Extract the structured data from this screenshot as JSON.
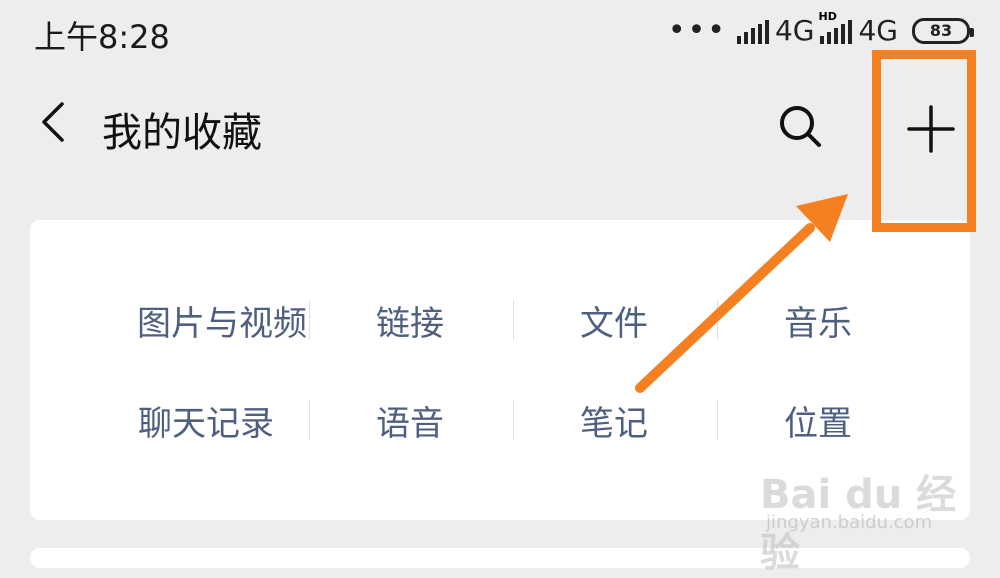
{
  "status_bar": {
    "time": "上午8:28",
    "dots": "•••",
    "network_1": "4G",
    "network_2": "4G",
    "hd_label": "HD",
    "battery": "83"
  },
  "header": {
    "title": "我的收藏",
    "back_icon": "chevron-left-icon",
    "search_icon": "search-icon",
    "add_icon": "plus-icon"
  },
  "categories": {
    "row1": [
      "图片与视频",
      "链接",
      "文件",
      "音乐"
    ],
    "row2": [
      "聊天记录",
      "语音",
      "笔记",
      "位置"
    ]
  },
  "annotation": {
    "highlight_color": "#f58021"
  },
  "watermark": {
    "logo": "Bai du 经验",
    "url": "jingyan.baidu.com"
  }
}
